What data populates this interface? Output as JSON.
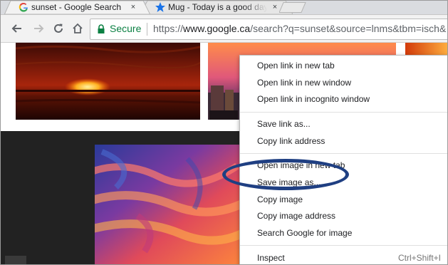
{
  "browser": {
    "tabs": [
      {
        "title": "sunset - Google Search",
        "favicon": "google-g-icon",
        "active": true,
        "close": "×"
      },
      {
        "title": "Mug - Today is a good day",
        "favicon": "blue-star-icon",
        "active": false,
        "close": "×"
      }
    ],
    "toolbar": {
      "back": "back-arrow-icon",
      "forward": "forward-arrow-icon",
      "reload": "reload-icon",
      "home": "home-icon",
      "secure_label": "Secure",
      "url_scheme": "https://",
      "url_host": "www.google.ca",
      "url_path": "/search?q=sunset&source=lnms&tbm=isch&"
    }
  },
  "context_menu": {
    "items": [
      {
        "label": "Open link in new tab"
      },
      {
        "label": "Open link in new window"
      },
      {
        "label": "Open link in incognito window"
      },
      {
        "label": "Save link as..."
      },
      {
        "label": "Copy link address"
      },
      {
        "label": "Open image in new tab"
      },
      {
        "label": "Save image as..."
      },
      {
        "label": "Copy image"
      },
      {
        "label": "Copy image address"
      },
      {
        "label": "Search Google for image"
      },
      {
        "label": "Inspect",
        "shortcut": "Ctrl+Shift+I"
      }
    ],
    "highlighted_item": "Save image as..."
  },
  "colors": {
    "secure_green": "#0b8043",
    "highlight_oval": "#1f3f82",
    "dark_panel": "#222222"
  }
}
